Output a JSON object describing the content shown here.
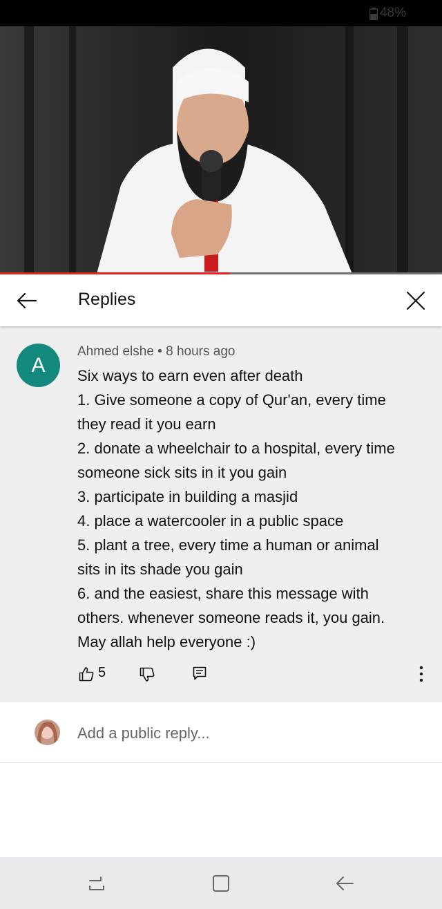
{
  "status_bar": {
    "battery": "48%"
  },
  "video": {
    "progress_fraction": 0.52
  },
  "header": {
    "title": "Replies"
  },
  "comment": {
    "avatar_letter": "A",
    "author": "Ahmed elshe",
    "separator": " • ",
    "time": "8 hours ago",
    "lines": [
      "Six ways to earn even after death",
      "1. Give someone a copy of Qur'an, every time",
      "they read it you earn",
      "2. donate a wheelchair to a hospital, every time",
      "someone sick sits in it you gain",
      "3. participate in building a masjid",
      "4. place a watercooler in a public space",
      "5. plant a tree, every time a human or animal",
      "sits in its shade you gain",
      "6. and the easiest, share this message with",
      "others. whenever someone reads it, you gain.",
      "May allah help everyone :)"
    ],
    "like_count": "5"
  },
  "reply_box": {
    "placeholder": "Add a public reply..."
  },
  "icons": {
    "back": "arrow-left-icon",
    "close": "close-icon",
    "like": "thumb-up-icon",
    "dislike": "thumb-down-icon",
    "reply": "reply-icon",
    "more": "more-vertical-icon",
    "nav_recent": "recent-apps-icon",
    "nav_home": "home-icon",
    "nav_back": "nav-back-icon"
  },
  "colors": {
    "avatar": "#12897c",
    "progress": "#e52222",
    "comment_bg": "#efefef"
  }
}
